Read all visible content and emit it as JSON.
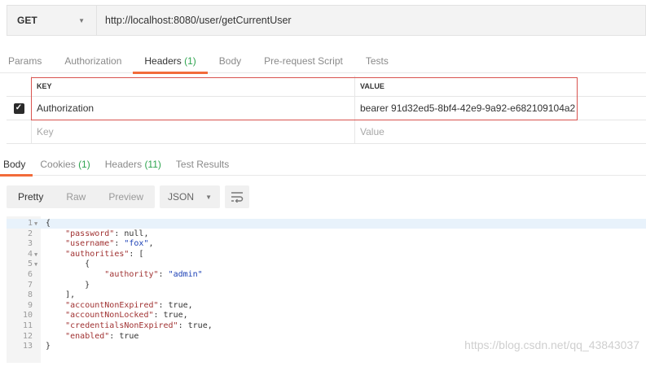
{
  "request": {
    "method": "GET",
    "url": "http://localhost:8080/user/getCurrentUser"
  },
  "request_tabs": [
    {
      "label": "Params"
    },
    {
      "label": "Authorization"
    },
    {
      "label": "Headers",
      "count": "(1)"
    },
    {
      "label": "Body"
    },
    {
      "label": "Pre-request Script"
    },
    {
      "label": "Tests"
    }
  ],
  "headers_table": {
    "key_header": "KEY",
    "value_header": "VALUE",
    "rows": [
      {
        "key": "Authorization",
        "value": "bearer 91d32ed5-8bf4-42e9-9a92-e682109104a2",
        "checked": true
      }
    ],
    "key_placeholder": "Key",
    "value_placeholder": "Value"
  },
  "response_tabs": [
    {
      "label": "Body"
    },
    {
      "label": "Cookies",
      "count": "(1)"
    },
    {
      "label": "Headers",
      "count": "(11)"
    },
    {
      "label": "Test Results"
    }
  ],
  "view": {
    "modes": [
      "Pretty",
      "Raw",
      "Preview"
    ],
    "format": "JSON"
  },
  "code_lines": [
    {
      "n": "1",
      "fold": true,
      "t": "{"
    },
    {
      "n": "2",
      "t": "    \"password\": null,"
    },
    {
      "n": "3",
      "t": "    \"username\": \"fox\","
    },
    {
      "n": "4",
      "fold": true,
      "t": "    \"authorities\": ["
    },
    {
      "n": "5",
      "fold": true,
      "t": "        {"
    },
    {
      "n": "6",
      "t": "            \"authority\": \"admin\""
    },
    {
      "n": "7",
      "t": "        }"
    },
    {
      "n": "8",
      "t": "    ],"
    },
    {
      "n": "9",
      "t": "    \"accountNonExpired\": true,"
    },
    {
      "n": "10",
      "t": "    \"accountNonLocked\": true,"
    },
    {
      "n": "11",
      "t": "    \"credentialsNonExpired\": true,"
    },
    {
      "n": "12",
      "t": "    \"enabled\": true"
    },
    {
      "n": "13",
      "t": "}"
    }
  ],
  "watermark": "https://blog.csdn.net/qq_43843037",
  "colors": {
    "accent": "#f26b3a",
    "count": "#2ea44f",
    "highlight": "#d9534f"
  }
}
